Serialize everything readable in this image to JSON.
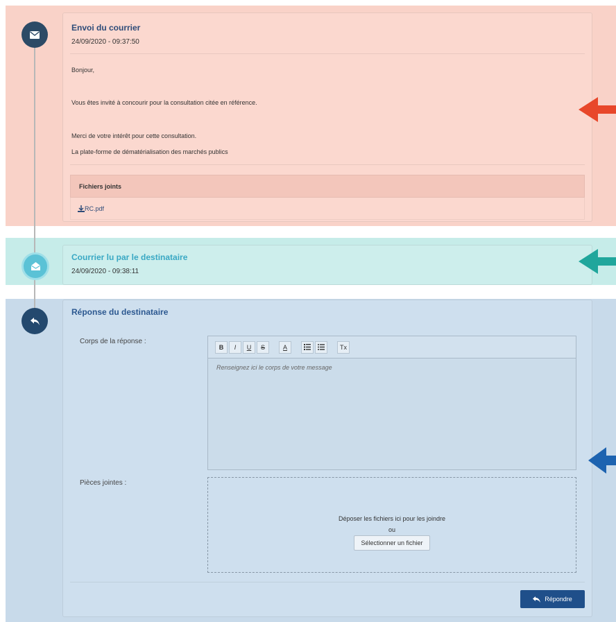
{
  "timeline": [
    {
      "title": "Envoi du courrier",
      "date": "24/09/2020 - 09:37:50",
      "body": [
        "Bonjour,",
        "Vous êtes invité à concourir pour la consultation citée en référence.",
        "Merci de votre intérêt pour cette consultation.",
        "La plate-forme de dématérialisation des marchés publics"
      ],
      "attachments_header": "Fichiers joints",
      "attachments": [
        "RC.pdf"
      ]
    },
    {
      "title": "Courrier lu par le destinataire",
      "date": "24/09/2020 - 09:38:11"
    },
    {
      "title": "Réponse du destinataire",
      "body_label": "Corps de la réponse :",
      "editor_placeholder": "Renseignez ici le corps de votre message",
      "attachments_label": "Pièces jointes :",
      "dropzone_text": "Déposer les fichiers ici pour les joindre",
      "dropzone_or": "ou",
      "select_file_button": "Sélectionner un fichier",
      "reply_button": "Répondre"
    }
  ],
  "toolbar": [
    "B",
    "I",
    "U",
    "S",
    "A",
    "ol",
    "ul",
    "Tx"
  ],
  "colors": {
    "red_band": "#f9d2c8",
    "teal_band": "#c6ece9",
    "blue_band": "#c8daea",
    "red_arrow": "#e8472a",
    "teal_arrow": "#20a69c",
    "blue_arrow": "#1d63b0",
    "reply_button": "#1f4f8a"
  }
}
